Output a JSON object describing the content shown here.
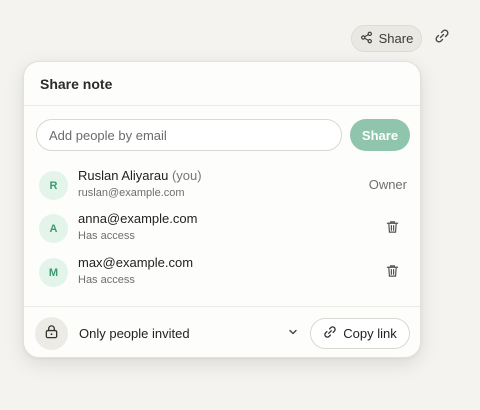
{
  "toolbar": {
    "share_label": "Share",
    "share_icon": "share-nodes-icon",
    "link_icon": "link-icon"
  },
  "dialog": {
    "title": "Share note",
    "email_placeholder": "Add people by email",
    "email_value": "",
    "share_button_label": "Share",
    "members": [
      {
        "initial": "R",
        "name": "Ruslan Aliyarau",
        "you_tag": "(you)",
        "sub": "ruslan@example.com",
        "role": "Owner"
      },
      {
        "initial": "A",
        "name": "anna@example.com",
        "you_tag": "",
        "sub": "Has access",
        "role": ""
      },
      {
        "initial": "M",
        "name": "max@example.com",
        "you_tag": "",
        "sub": "Has access",
        "role": ""
      }
    ],
    "access_label": "Only people invited",
    "copy_link_label": "Copy link"
  },
  "colors": {
    "accent": "#8fc5ac",
    "avatar_bg": "#e3f4ea",
    "avatar_fg": "#3d9a6d",
    "background": "#f4f3ef"
  }
}
